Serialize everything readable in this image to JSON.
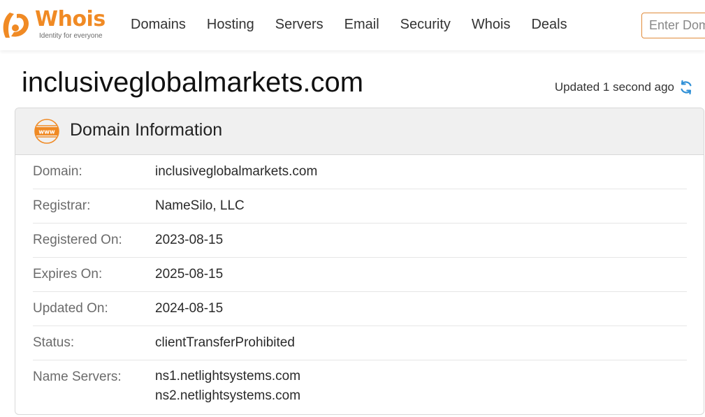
{
  "header": {
    "logo_text": "Whois",
    "logo_tagline": "Identity for everyone",
    "nav": [
      "Domains",
      "Hosting",
      "Servers",
      "Email",
      "Security",
      "Whois",
      "Deals"
    ],
    "search_placeholder": "Enter Domain"
  },
  "page": {
    "title": "inclusiveglobalmarkets.com",
    "updated": "Updated 1 second ago"
  },
  "card": {
    "title": "Domain Information",
    "rows": [
      {
        "label": "Domain:",
        "value": "inclusiveglobalmarkets.com"
      },
      {
        "label": "Registrar:",
        "value": "NameSilo, LLC"
      },
      {
        "label": "Registered On:",
        "value": "2023-08-15"
      },
      {
        "label": "Expires On:",
        "value": "2025-08-15"
      },
      {
        "label": "Updated On:",
        "value": "2024-08-15"
      },
      {
        "label": "Status:",
        "value": "clientTransferProhibited"
      }
    ],
    "name_servers": {
      "label": "Name Servers:",
      "values": [
        "ns1.netlightsystems.com",
        "ns2.netlightsystems.com"
      ]
    }
  },
  "colors": {
    "brand": "#f08a24",
    "refresh": "#2e8fd6"
  }
}
